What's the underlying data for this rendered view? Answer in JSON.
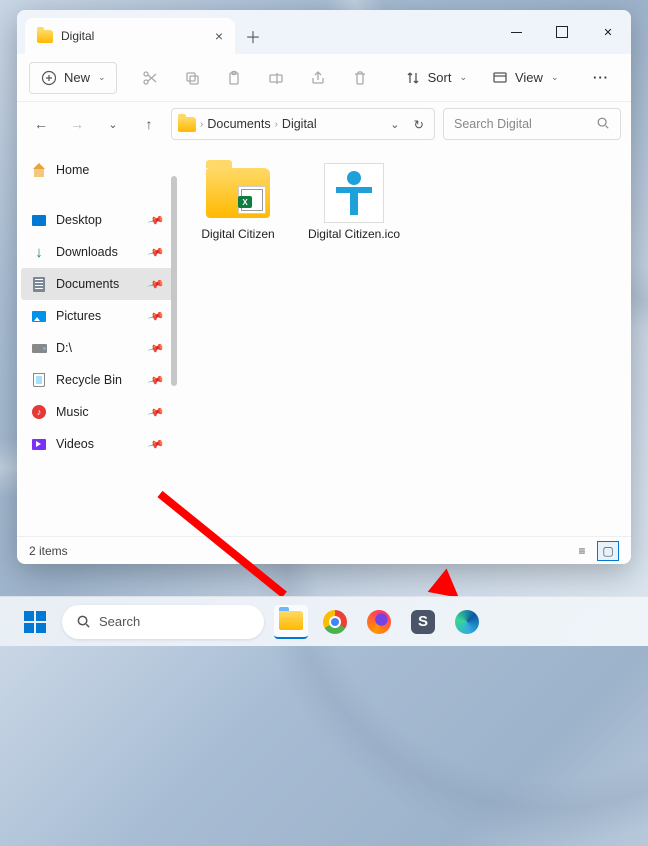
{
  "tab": {
    "title": "Digital",
    "close": "×",
    "new": "＋"
  },
  "window_controls": {
    "close": "✕"
  },
  "toolbar": {
    "new_label": "New",
    "sort_label": "Sort",
    "view_label": "View",
    "more": "···"
  },
  "nav": {
    "back": "←",
    "forward": "→",
    "recent": "⌄",
    "up": "↑"
  },
  "address": {
    "crumbs": [
      "Documents",
      "Digital"
    ],
    "sep": "›",
    "refresh": "↻",
    "dropdown": "⌄"
  },
  "search": {
    "placeholder": "Search Digital"
  },
  "sidebar": {
    "home": "Home",
    "items": [
      {
        "label": "Desktop"
      },
      {
        "label": "Downloads"
      },
      {
        "label": "Documents"
      },
      {
        "label": "Pictures"
      },
      {
        "label": "D:\\"
      },
      {
        "label": "Recycle Bin"
      },
      {
        "label": "Music"
      },
      {
        "label": "Videos"
      }
    ]
  },
  "files": [
    {
      "label": "Digital Citizen"
    },
    {
      "label": "Digital Citizen.ico"
    }
  ],
  "status": {
    "count": "2 items"
  },
  "taskbar": {
    "search": "Search",
    "sogou": "S"
  }
}
